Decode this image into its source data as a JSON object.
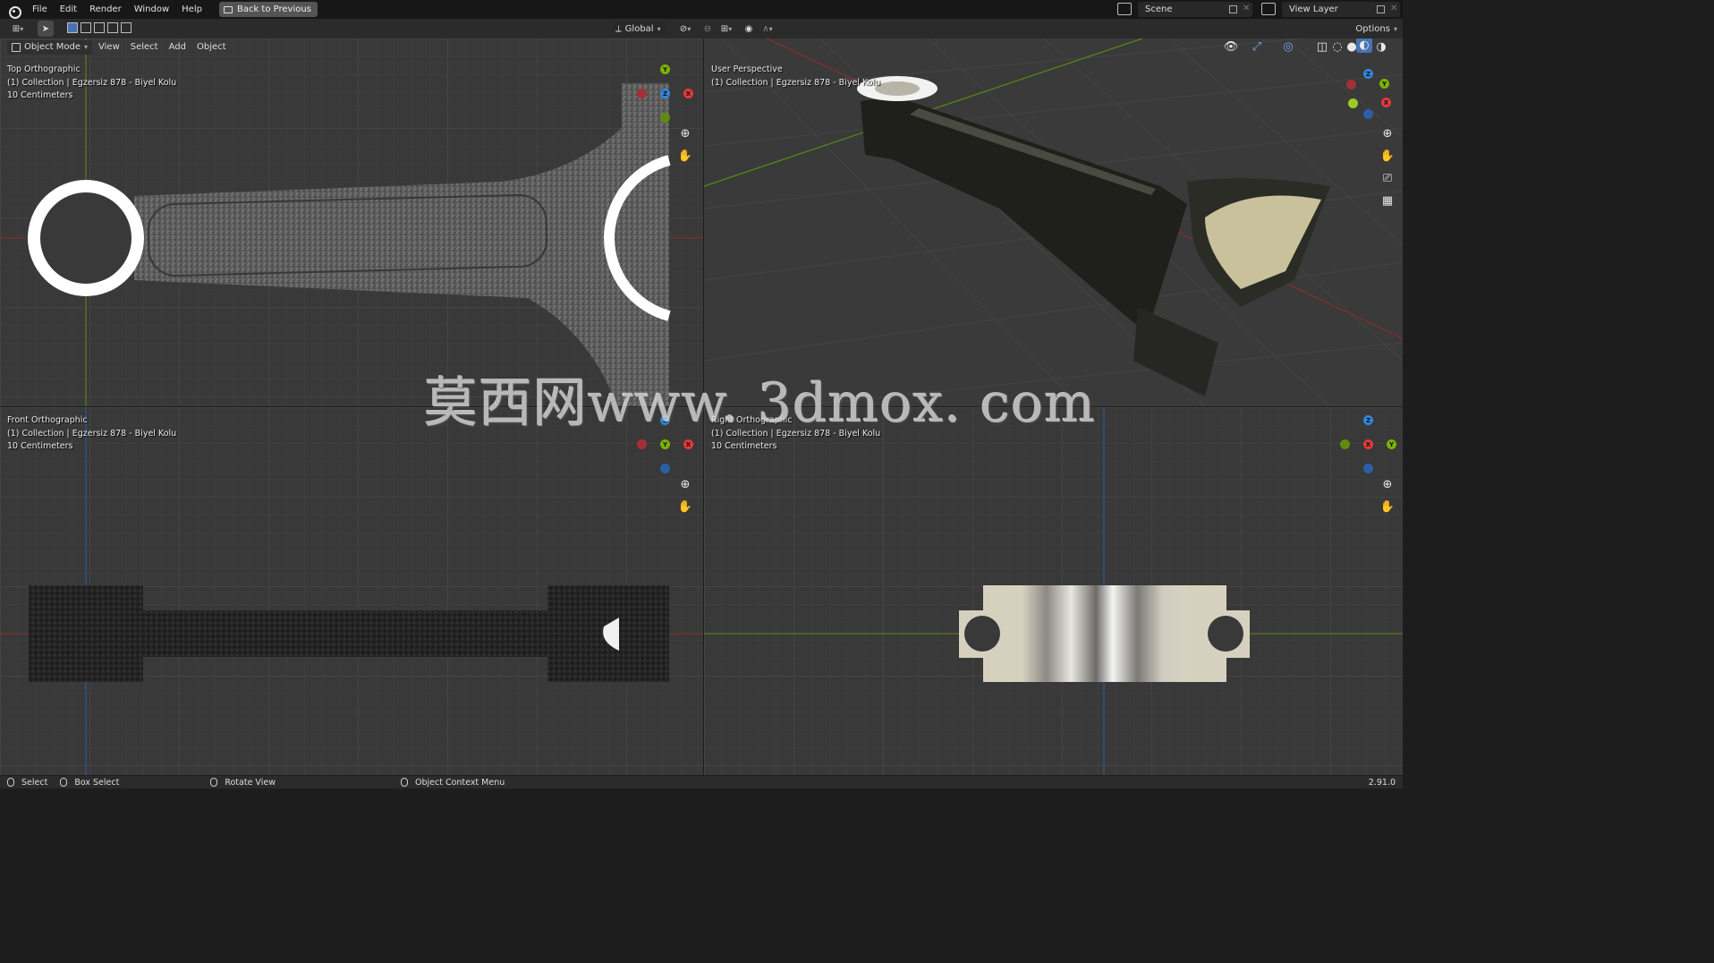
{
  "topbar": {
    "menus": [
      "File",
      "Edit",
      "Render",
      "Window",
      "Help"
    ],
    "back_button": "Back to Previous",
    "scene_name": "Scene",
    "view_layer_name": "View Layer"
  },
  "toolbar": {
    "transform_orientation": "Global",
    "options_label": "Options"
  },
  "viewport_header": {
    "mode": "Object Mode",
    "menus": [
      "View",
      "Select",
      "Add",
      "Object"
    ]
  },
  "viewports": {
    "top_left": {
      "view": "Top Orthographic",
      "collection": "(1) Collection | Egzersiz 878 - Biyel Kolu",
      "scale": "10 Centimeters"
    },
    "top_right": {
      "view": "User Perspective",
      "collection": "(1) Collection | Egzersiz 878 - Biyel Kolu"
    },
    "bottom_left": {
      "view": "Front Orthographic",
      "collection": "(1) Collection | Egzersiz 878 - Biyel Kolu",
      "scale": "10 Centimeters"
    },
    "bottom_right": {
      "view": "Right Orthographic",
      "collection": "(1) Collection | Egzersiz 878 - Biyel Kolu",
      "scale": "10 Centimeters"
    }
  },
  "axes": {
    "x": "X",
    "y": "Y",
    "z": "Z"
  },
  "status_bar": {
    "select": "Select",
    "box_select": "Box Select",
    "rotate_view": "Rotate View",
    "context_menu": "Object Context Menu",
    "version": "2.91.0"
  },
  "watermark": "莫西网www. 3dmox. com",
  "colors": {
    "axis_x": "#e5383f",
    "axis_y": "#7bb200",
    "axis_z": "#2f86e0",
    "grid_x_line": "#8a2d2d",
    "grid_y_line": "#5a8a12",
    "grid_z_line": "#2a5fa8"
  }
}
